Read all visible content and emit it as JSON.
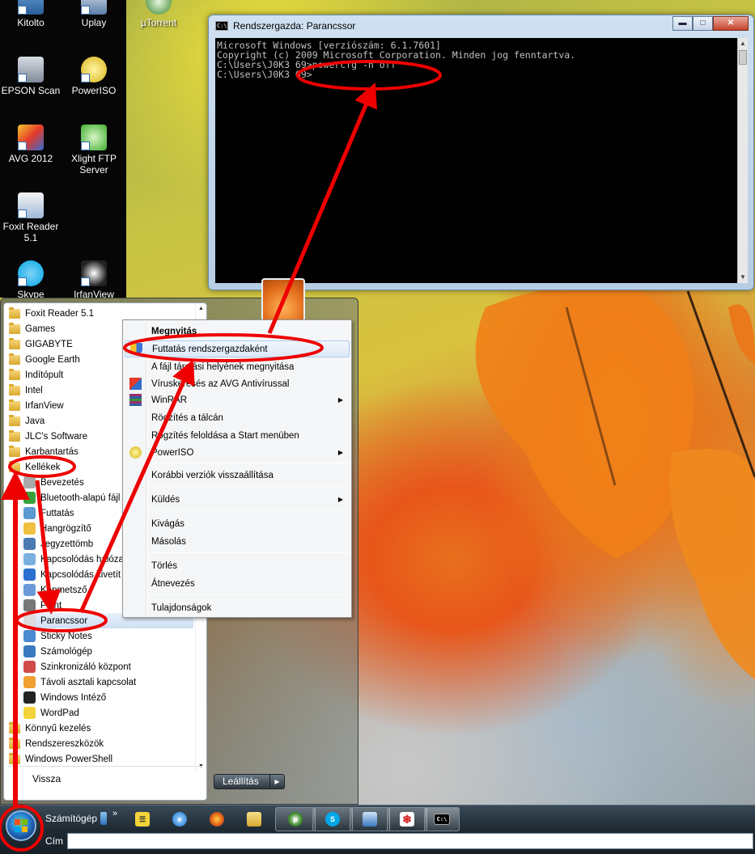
{
  "desktop_icons": [
    {
      "label": "Kitolto"
    },
    {
      "label": "Uplay"
    },
    {
      "label": "µTorrent"
    },
    {
      "label": "EPSON Scan"
    },
    {
      "label": "PowerISO"
    },
    {
      "label": "AVG 2012"
    },
    {
      "label": "Xlight FTP Server"
    },
    {
      "label": "Foxit Reader 5.1"
    },
    {
      "label": "Skype"
    },
    {
      "label": "IrfanView"
    }
  ],
  "cmd_window": {
    "title": "Rendszergazda: Parancssor",
    "icon": "cmd-icon",
    "controls": {
      "minimize": "minimize-icon",
      "maximize": "maximize-icon",
      "close": "close-icon"
    },
    "lines": [
      "Microsoft Windows [verziószám: 6.1.7601]",
      "Copyright (c) 2009 Microsoft Corporation. Minden jog fenntartva.",
      "",
      "C:\\Users\\J0K3 69>powercfg -h off",
      "",
      "C:\\Users\\J0K3 69>"
    ]
  },
  "start_menu": {
    "programs": [
      {
        "label": "Foxit Reader 5.1",
        "type": "folder"
      },
      {
        "label": "Games",
        "type": "folder"
      },
      {
        "label": "GIGABYTE",
        "type": "folder"
      },
      {
        "label": "Google Earth",
        "type": "folder"
      },
      {
        "label": "Indítópult",
        "type": "folder"
      },
      {
        "label": "Intel",
        "type": "folder"
      },
      {
        "label": "IrfanView",
        "type": "folder"
      },
      {
        "label": "Java",
        "type": "folder"
      },
      {
        "label": "JLC's Software",
        "type": "folder"
      },
      {
        "label": "Karbantartás",
        "type": "folder"
      },
      {
        "label": "Kellékek",
        "type": "folder"
      },
      {
        "label": "Bevezetés",
        "type": "app"
      },
      {
        "label": "Bluetooth-alapú fájl",
        "type": "app"
      },
      {
        "label": "Futtatás",
        "type": "app"
      },
      {
        "label": "Hangrögzítő",
        "type": "app"
      },
      {
        "label": "Jegyzettömb",
        "type": "app"
      },
      {
        "label": "Kapcsolódás hálóza",
        "type": "app"
      },
      {
        "label": "Kapcsolódás kivetít",
        "type": "app"
      },
      {
        "label": "Képmetsző",
        "type": "app"
      },
      {
        "label": "Paint",
        "type": "app"
      },
      {
        "label": "Parancssor",
        "type": "app"
      },
      {
        "label": "Sticky Notes",
        "type": "app"
      },
      {
        "label": "Számológép",
        "type": "app"
      },
      {
        "label": "Szinkronizáló központ",
        "type": "app"
      },
      {
        "label": "Távoli asztali kapcsolat",
        "type": "app"
      },
      {
        "label": "Windows Intéző",
        "type": "app"
      },
      {
        "label": "WordPad",
        "type": "app"
      },
      {
        "label": "Könnyű kezelés",
        "type": "folder"
      },
      {
        "label": "Rendszereszközök",
        "type": "folder"
      },
      {
        "label": "Windows PowerShell",
        "type": "folder"
      }
    ],
    "back_label": "Vissza",
    "shutdown_label": "Leállítás"
  },
  "context_menu": {
    "items": [
      {
        "label": "Megnyitás",
        "bold": true
      },
      {
        "label": "Futtatás rendszergazdaként",
        "icon": "shield-icon",
        "highlighted": true
      },
      {
        "label": "A fájl tárolási helyének megnyitása"
      },
      {
        "label": "Víruskeresés az AVG Antivírussal",
        "icon": "avg-icon"
      },
      {
        "label": "WinRAR",
        "icon": "winrar-icon",
        "submenu": true
      },
      {
        "label": "Rögzítés a tálcán"
      },
      {
        "label": "Rögzítés feloldása a Start menüben"
      },
      {
        "label": "PowerISO",
        "icon": "poweriso-icon",
        "submenu": true
      },
      {
        "label": "Korábbi verziók visszaállítása"
      },
      {
        "label": "Küldés",
        "submenu": true
      },
      {
        "label": "Kivágás"
      },
      {
        "label": "Másolás"
      },
      {
        "label": "Törlés"
      },
      {
        "label": "Átnevezés"
      },
      {
        "label": "Tulajdonságok"
      }
    ]
  },
  "taskbar": {
    "computer_label": "Számítógép",
    "overflow": "»",
    "address_label": "Cím",
    "address_value": ""
  },
  "colors": {
    "annotation": "#ee0000",
    "console_bg": "#000000",
    "console_text": "#c0c0c0"
  }
}
